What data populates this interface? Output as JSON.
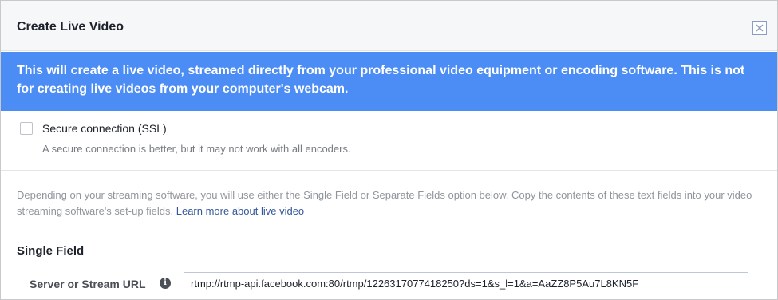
{
  "dialog": {
    "title": "Create Live Video",
    "close_icon": "close-icon"
  },
  "banner": {
    "text": "This will create a live video, streamed directly from your professional video equipment or encoding software. This is not for creating live videos from your computer's webcam."
  },
  "ssl": {
    "label": "Secure connection (SSL)",
    "checked": false,
    "help": "A secure connection is better, but it may not work with all encoders."
  },
  "instructions": {
    "text": "Depending on your streaming software, you will use either the Single Field or Separate Fields option below. Copy the contents of these text fields into your video streaming software's set-up fields. ",
    "link": "Learn more about live video"
  },
  "single_field": {
    "section_title": "Single Field",
    "label": "Server or Stream URL",
    "info_icon": "info-icon",
    "value": "rtmp://rtmp-api.facebook.com:80/rtmp/1226317077418250?ds=1&s_l=1&a=AaZZ8P5Au7L8KN5F"
  },
  "colors": {
    "banner_bg": "#4b8cf5",
    "link": "#365899"
  }
}
